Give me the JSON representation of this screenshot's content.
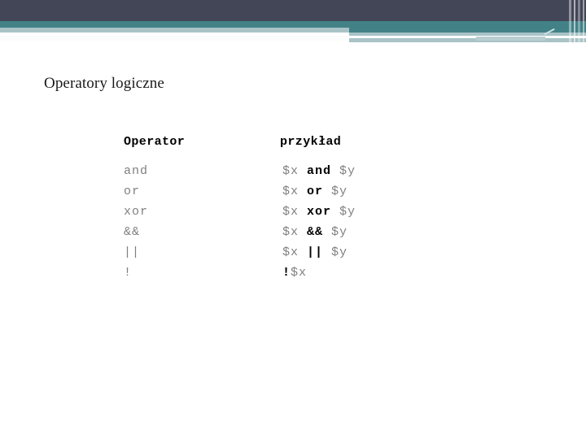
{
  "slide": {
    "title": "Operatory logiczne",
    "banner": {
      "dark_color": "#434657",
      "teal_color": "#428287",
      "pale_color": "#a9c3c6",
      "accent_color": "#b9ced1"
    }
  },
  "table": {
    "headers": {
      "operator": "Operator",
      "example": "przykład"
    },
    "rows": [
      {
        "operator": "and",
        "ex_pre": "$x ",
        "ex_op": "and",
        "ex_post": " $y"
      },
      {
        "operator": "or",
        "ex_pre": "$x ",
        "ex_op": "or",
        "ex_post": " $y"
      },
      {
        "operator": "xor",
        "ex_pre": "$x ",
        "ex_op": "xor",
        "ex_post": " $y"
      },
      {
        "operator": "&&",
        "ex_pre": "$x ",
        "ex_op": "&&",
        "ex_post": " $y"
      },
      {
        "operator": "||",
        "ex_pre": "$x ",
        "ex_op": "||",
        "ex_post": " $y"
      },
      {
        "operator": "!",
        "ex_pre": "",
        "ex_op": "!",
        "ex_post": "$x"
      }
    ]
  }
}
